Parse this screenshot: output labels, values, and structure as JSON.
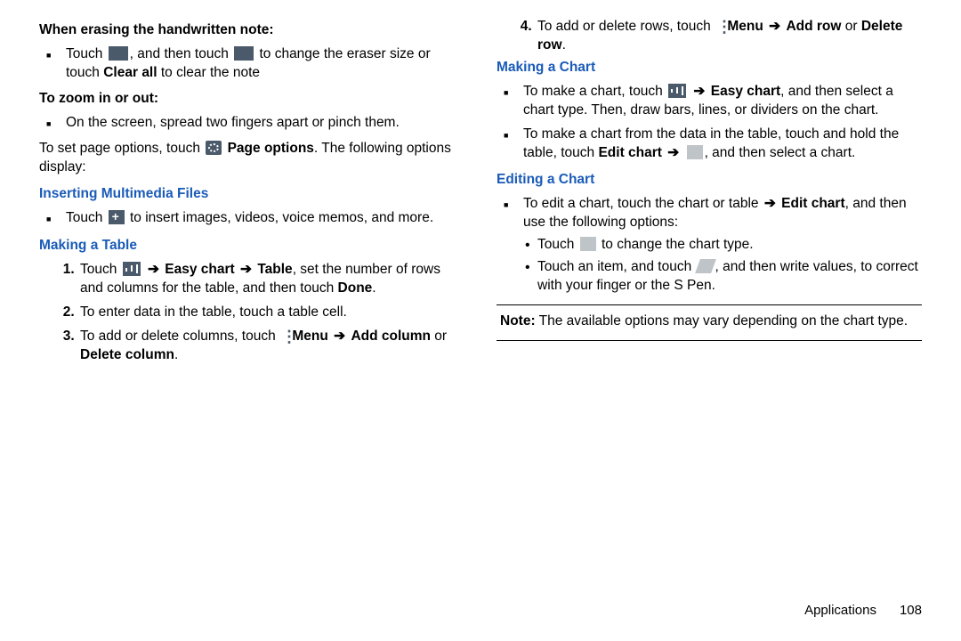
{
  "col1": {
    "erasing": {
      "heading": "When erasing the handwritten note:",
      "item1_a": "Touch ",
      "item1_b": ", and then touch ",
      "item1_c": " to change the eraser size or touch ",
      "clear_all": "Clear all",
      "item1_d": " to clear the note"
    },
    "zoom": {
      "heading": "To zoom in or out:",
      "item1": "On the screen, spread two fingers apart or pinch them."
    },
    "page_opts": {
      "a": "To set page options, touch ",
      "b": "Page options",
      "c": ". The following options display:"
    },
    "insert": {
      "heading": "Inserting Multimedia Files",
      "item1_a": "Touch ",
      "item1_b": " to insert images, videos, voice memos, and more."
    },
    "table": {
      "heading": "Making a Table",
      "st1_a": "Touch ",
      "st1_b": "Easy chart",
      "st1_c": "Table",
      "st1_d": ", set the number of rows and columns for the table, and then touch ",
      "done": "Done",
      "st1_e": ".",
      "st2": "To enter data in the table, touch a table cell.",
      "st3_a": "To add or delete columns, touch ",
      "menu": "Menu",
      "st3_b": "Add column",
      "or": " or ",
      "st3_c": "Delete column",
      "st3_d": ".",
      "st4_a": "To add or delete rows, touch ",
      "st4_b": "Add row",
      "st4_c": "Delete row",
      "st4_d": "."
    }
  },
  "col2": {
    "make_chart": {
      "heading": "Making a Chart",
      "it1_a": "To make a chart, touch ",
      "it1_b": "Easy chart",
      "it1_c": ", and then select a chart type. Then, draw bars, lines, or dividers on the chart.",
      "it2_a": "To make a chart from the data in the table, touch and hold the table, touch ",
      "edit_chart": "Edit chart",
      "it2_b": ", and then select a chart."
    },
    "edit_chart_sec": {
      "heading": "Editing a Chart",
      "it1_a": "To edit a chart, touch the chart or table ",
      "edit_chart": "Edit chart",
      "it1_b": ", and then use the following options:",
      "sub1_a": "Touch ",
      "sub1_b": " to change the chart type.",
      "sub2_a": "Touch an item, and touch ",
      "sub2_b": ", and then write values, to correct with your finger or the S Pen."
    },
    "note": {
      "label": "Note:",
      "text": " The available options may vary depending on the chart type."
    }
  },
  "arrow": "➔",
  "footer": {
    "section": "Applications",
    "page": "108"
  }
}
